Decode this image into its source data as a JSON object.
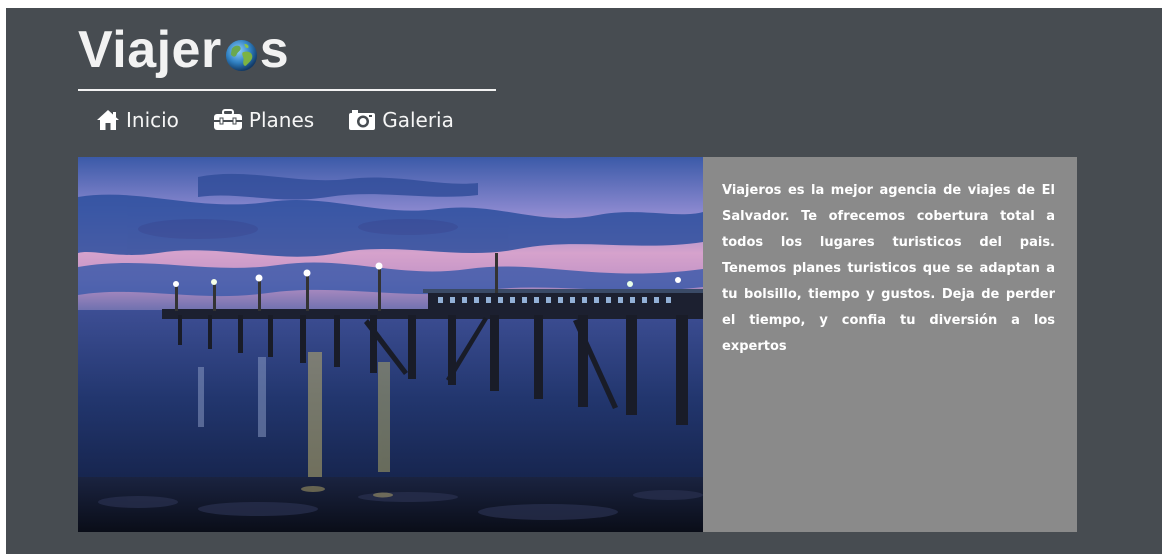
{
  "brand": {
    "logo_prefix": "Viajer",
    "logo_suffix": "s",
    "logo_icon": "globe-icon"
  },
  "nav": {
    "items": [
      {
        "label": "Inicio",
        "icon": "home-icon"
      },
      {
        "label": "Planes",
        "icon": "suitcase-icon"
      },
      {
        "label": "Galeria",
        "icon": "camera-icon"
      }
    ]
  },
  "hero": {
    "image": "pier-at-dusk-photo"
  },
  "info": {
    "text": "Viajeros es la mejor agencia de viajes de El Salvador. Te ofrecemos cobertura total a todos los lugares turisticos del pais. Tenemos planes turisticos que se adaptan a tu bolsillo, tiempo y gustos. Deja de perder el tiempo, y confia tu diversión a los expertos"
  },
  "colors": {
    "background": "#474c51",
    "panel": "#8a8a8a",
    "text": "#ffffff"
  }
}
